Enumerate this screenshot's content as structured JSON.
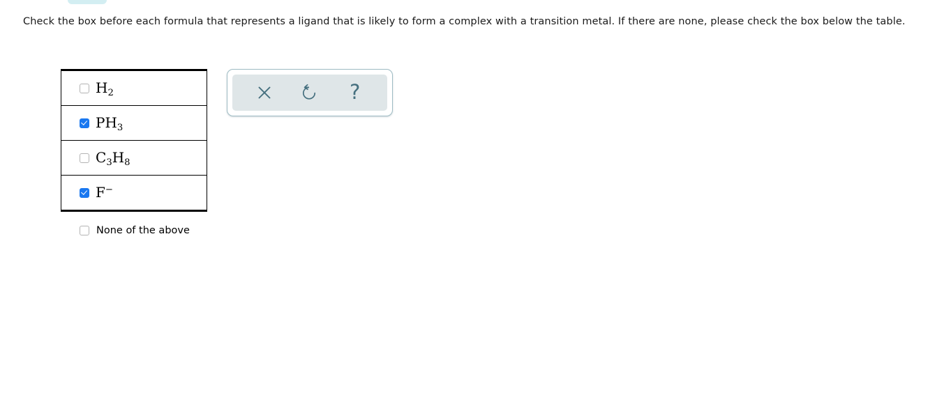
{
  "page": {
    "background_color": "#ffffff",
    "top_tab_color": "#d3eef2"
  },
  "prompt": {
    "text": "Check the box before each formula that represents a ligand that is likely to form a complex with a transition metal. If there are none, please check the box below the table."
  },
  "table": {
    "accent_checked_color": "#1a78f0",
    "rows": [
      {
        "checked": false,
        "formula_plain": "H2",
        "formula_parts": [
          {
            "type": "text",
            "value": "H"
          },
          {
            "type": "sub",
            "value": "2"
          }
        ]
      },
      {
        "checked": true,
        "formula_plain": "PH3",
        "formula_parts": [
          {
            "type": "text",
            "value": "PH"
          },
          {
            "type": "sub",
            "value": "3"
          }
        ]
      },
      {
        "checked": false,
        "formula_plain": "C3H8",
        "formula_parts": [
          {
            "type": "text",
            "value": "C"
          },
          {
            "type": "sub",
            "value": "3"
          },
          {
            "type": "text",
            "value": "H"
          },
          {
            "type": "sub",
            "value": "8"
          }
        ]
      },
      {
        "checked": true,
        "formula_plain": "F-",
        "formula_parts": [
          {
            "type": "text",
            "value": "F"
          },
          {
            "type": "sup",
            "value": "−"
          }
        ]
      }
    ]
  },
  "none_of_the_above": {
    "label": "None of the above",
    "checked": false
  },
  "toolbar": {
    "icon_color": "#46707f",
    "panel_background": "#dfe6e8",
    "panel_border_color": "#9fbcc4",
    "buttons": [
      {
        "name": "close-icon",
        "glyph": "×",
        "tooltip": "Clear"
      },
      {
        "name": "undo-icon",
        "glyph": "↺",
        "tooltip": "Undo"
      },
      {
        "name": "help-icon",
        "glyph": "?",
        "tooltip": "Help"
      }
    ]
  }
}
